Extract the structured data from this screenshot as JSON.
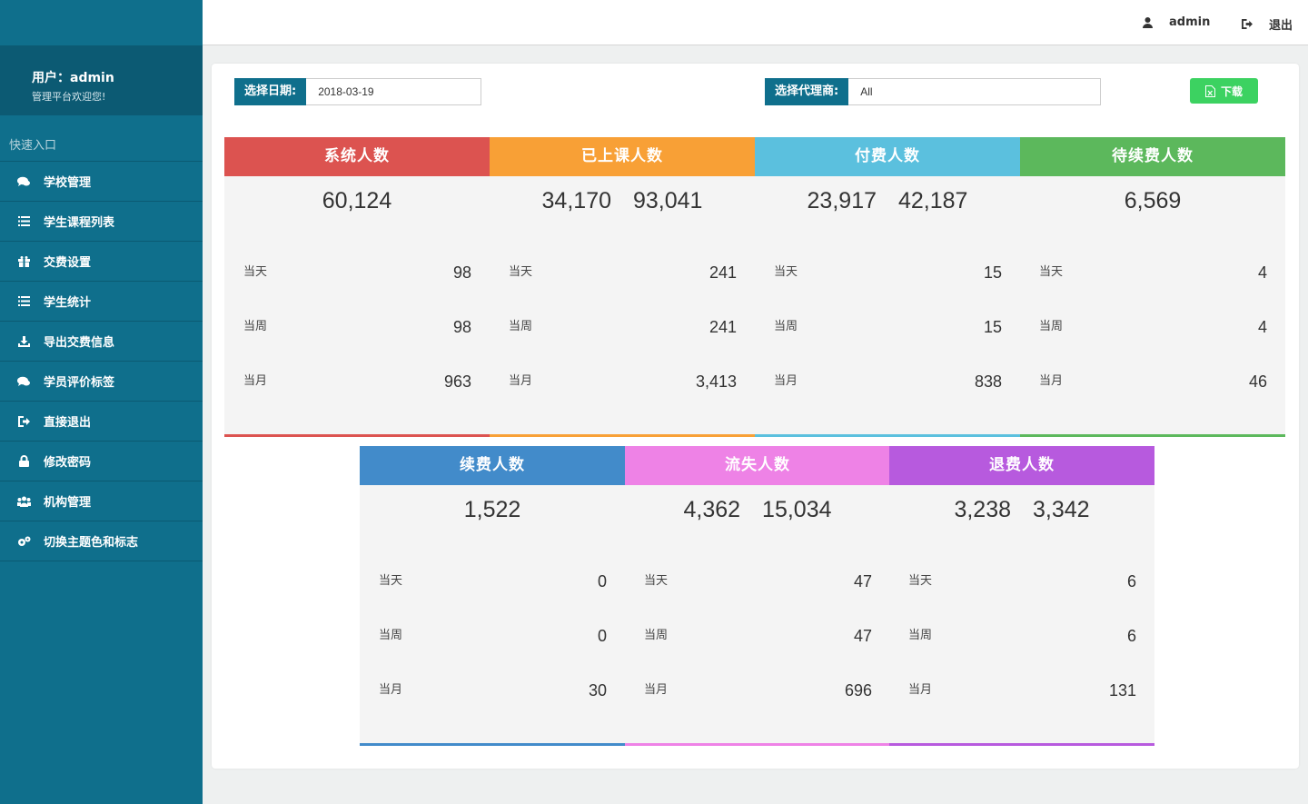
{
  "sidebar": {
    "user_label": "用户：admin",
    "welcome": "管理平台欢迎您!",
    "quick_entry": "快速入口",
    "items": [
      {
        "label": "学校管理",
        "icon": "comments-icon"
      },
      {
        "label": "学生课程列表",
        "icon": "list-icon"
      },
      {
        "label": "交费设置",
        "icon": "gift-icon"
      },
      {
        "label": "学生统计",
        "icon": "list-icon"
      },
      {
        "label": "导出交费信息",
        "icon": "download-icon"
      },
      {
        "label": "学员评价标签",
        "icon": "comments-icon"
      },
      {
        "label": "直接退出",
        "icon": "sign-out-icon"
      },
      {
        "label": "修改密码",
        "icon": "lock-icon"
      },
      {
        "label": "机构管理",
        "icon": "group-icon"
      },
      {
        "label": "切换主题色和标志",
        "icon": "cogs-icon"
      }
    ]
  },
  "header": {
    "username": "admin",
    "logout": "退出"
  },
  "filters": {
    "date_label": "选择日期:",
    "date_value": "2018-03-19",
    "agent_label": "选择代理商:",
    "agent_value": "All",
    "download": "下载"
  },
  "row_labels": {
    "day": "当天",
    "week": "当周",
    "month": "当月"
  },
  "cards": [
    {
      "title": "系统人数",
      "color": "#dc5350",
      "main": [
        "60,124"
      ],
      "day": "98",
      "week": "98",
      "month": "963"
    },
    {
      "title": "已上课人数",
      "color": "#f8a036",
      "main": [
        "34,170",
        "93,041"
      ],
      "day": "241",
      "week": "241",
      "month": "3,413"
    },
    {
      "title": "付费人数",
      "color": "#5bc0de",
      "main": [
        "23,917",
        "42,187"
      ],
      "day": "15",
      "week": "15",
      "month": "838"
    },
    {
      "title": "待续费人数",
      "color": "#5cb85c",
      "main": [
        "6,569"
      ],
      "day": "4",
      "week": "4",
      "month": "46"
    },
    {
      "title": "续费人数",
      "color": "#428bca",
      "main": [
        "1,522"
      ],
      "day": "0",
      "week": "0",
      "month": "30"
    },
    {
      "title": "流失人数",
      "color": "#ee82e6",
      "main": [
        "4,362",
        "15,034"
      ],
      "day": "47",
      "week": "47",
      "month": "696"
    },
    {
      "title": "退费人数",
      "color": "#b75ade",
      "main": [
        "3,238",
        "3,342"
      ],
      "day": "6",
      "week": "6",
      "month": "131"
    }
  ]
}
